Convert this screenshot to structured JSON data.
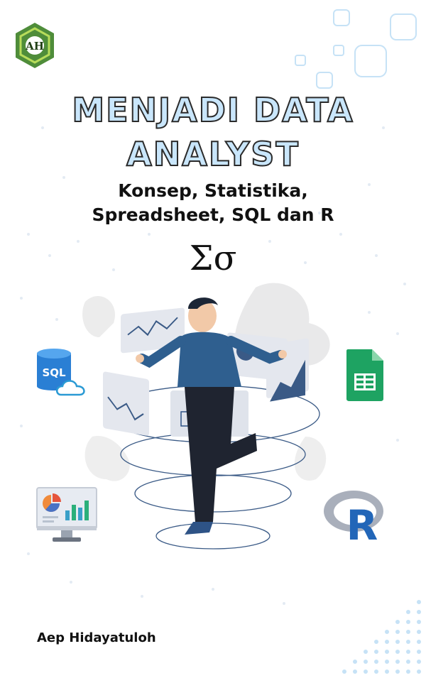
{
  "cover": {
    "title_line1": "MENJADI DATA",
    "title_line2": "ANALYST",
    "subtitle_line1": "Konsep, Statistika,",
    "subtitle_line2": "Spreadsheet, SQL dan R",
    "symbol": "Σσ",
    "author": "Aep Hidayatuloh"
  },
  "logo": {
    "text": "AH"
  },
  "icons": {
    "sql": {
      "label": "SQL",
      "name": "sql-database-cloud-icon"
    },
    "sheets": {
      "name": "google-sheets-icon"
    },
    "monitor": {
      "name": "dashboard-monitor-icon"
    },
    "r": {
      "label": "R",
      "name": "r-language-icon"
    }
  },
  "colors": {
    "title_fill": "#c9e6fb",
    "title_stroke": "#2b2b2b",
    "accent_blue": "#2b6cb0",
    "figure_shirt": "#2f5f8f",
    "sheets_green": "#1ea362",
    "logo_green": "#4f8d3a"
  }
}
